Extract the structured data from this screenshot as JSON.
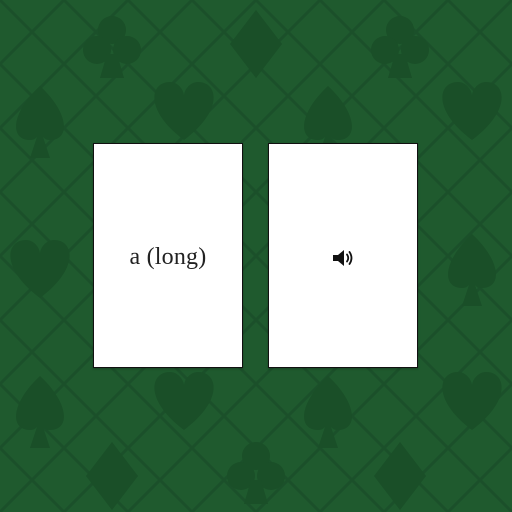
{
  "table": {
    "background_color": "#1f5a2e",
    "pattern_color": "#1a4f28",
    "pattern_suits": [
      "club-icon",
      "diamond-icon",
      "spade-icon",
      "heart-icon"
    ]
  },
  "cards": [
    {
      "face": "text",
      "text": "a (long)"
    },
    {
      "face": "icon",
      "icon": "speaker-icon"
    }
  ]
}
